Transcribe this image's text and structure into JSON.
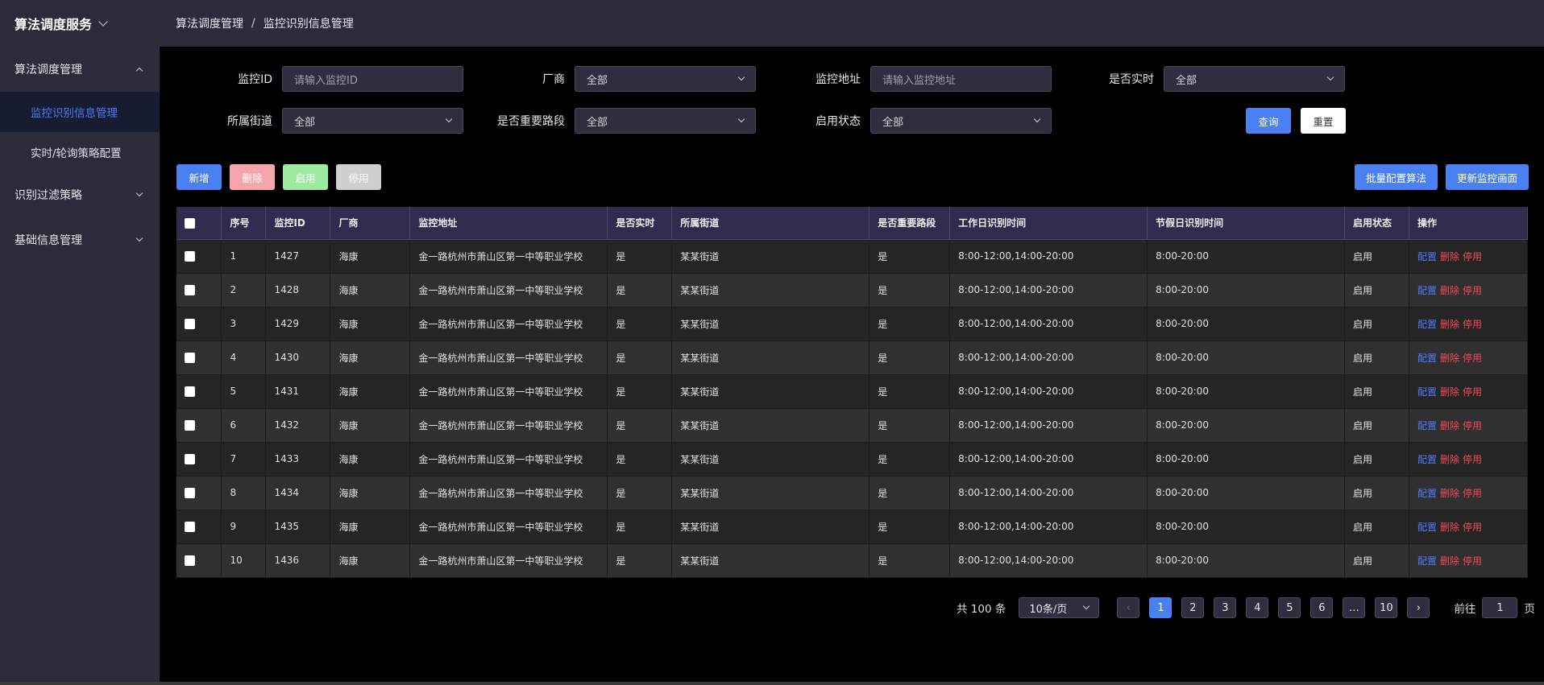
{
  "sidebar": {
    "app_title": "算法调度服务",
    "groups": [
      {
        "label": "算法调度管理",
        "children": [
          "监控识别信息管理",
          "实时/轮询策略配置"
        ]
      },
      {
        "label": "识别过滤策略"
      },
      {
        "label": "基础信息管理"
      }
    ]
  },
  "breadcrumb": {
    "root": "算法调度管理",
    "sep": "/",
    "current": "监控识别信息管理"
  },
  "filters": {
    "monitor_id": {
      "label": "监控ID",
      "placeholder": "请输入监控ID"
    },
    "vendor": {
      "label": "厂商",
      "value": "全部"
    },
    "address": {
      "label": "监控地址",
      "placeholder": "请输入监控地址"
    },
    "realtime": {
      "label": "是否实时",
      "value": "全部"
    },
    "street": {
      "label": "所属街道",
      "value": "全部"
    },
    "important_road": {
      "label": "是否重要路段",
      "value": "全部"
    },
    "enabled": {
      "label": "启用状态",
      "value": "全部"
    },
    "query_label": "查询",
    "reset_label": "重置"
  },
  "actions": {
    "add": "新增",
    "delete": "删除",
    "enable": "启用",
    "disable": "停用",
    "batch_config": "批量配置算法",
    "update_view": "更新监控画面",
    "colors": {
      "add": "#4a80f0",
      "delete": "#f7a5ad",
      "enable": "#9deba0",
      "disable": "#cfcfcf"
    }
  },
  "table": {
    "headers": [
      "序号",
      "监控ID",
      "厂商",
      "监控地址",
      "是否实时",
      "所属街道",
      "是否重要路段",
      "工作日识别时间",
      "节假日识别时间",
      "启用状态",
      "操作"
    ],
    "op_labels": {
      "config": "配置",
      "delete": "删除",
      "disable": "停用"
    },
    "rows": [
      [
        "1",
        "1427",
        "海康",
        "金一路杭州市萧山区第一中等职业学校",
        "是",
        "某某街道",
        "是",
        "8:00-12:00,14:00-20:00",
        "8:00-20:00",
        "启用"
      ],
      [
        "2",
        "1428",
        "海康",
        "金一路杭州市萧山区第一中等职业学校",
        "是",
        "某某街道",
        "是",
        "8:00-12:00,14:00-20:00",
        "8:00-20:00",
        "启用"
      ],
      [
        "3",
        "1429",
        "海康",
        "金一路杭州市萧山区第一中等职业学校",
        "是",
        "某某街道",
        "是",
        "8:00-12:00,14:00-20:00",
        "8:00-20:00",
        "启用"
      ],
      [
        "4",
        "1430",
        "海康",
        "金一路杭州市萧山区第一中等职业学校",
        "是",
        "某某街道",
        "是",
        "8:00-12:00,14:00-20:00",
        "8:00-20:00",
        "启用"
      ],
      [
        "5",
        "1431",
        "海康",
        "金一路杭州市萧山区第一中等职业学校",
        "是",
        "某某街道",
        "是",
        "8:00-12:00,14:00-20:00",
        "8:00-20:00",
        "启用"
      ],
      [
        "6",
        "1432",
        "海康",
        "金一路杭州市萧山区第一中等职业学校",
        "是",
        "某某街道",
        "是",
        "8:00-12:00,14:00-20:00",
        "8:00-20:00",
        "启用"
      ],
      [
        "7",
        "1433",
        "海康",
        "金一路杭州市萧山区第一中等职业学校",
        "是",
        "某某街道",
        "是",
        "8:00-12:00,14:00-20:00",
        "8:00-20:00",
        "启用"
      ],
      [
        "8",
        "1434",
        "海康",
        "金一路杭州市萧山区第一中等职业学校",
        "是",
        "某某街道",
        "是",
        "8:00-12:00,14:00-20:00",
        "8:00-20:00",
        "启用"
      ],
      [
        "9",
        "1435",
        "海康",
        "金一路杭州市萧山区第一中等职业学校",
        "是",
        "某某街道",
        "是",
        "8:00-12:00,14:00-20:00",
        "8:00-20:00",
        "启用"
      ],
      [
        "10",
        "1436",
        "海康",
        "金一路杭州市萧山区第一中等职业学校",
        "是",
        "某某街道",
        "是",
        "8:00-12:00,14:00-20:00",
        "8:00-20:00",
        "启用"
      ]
    ]
  },
  "pagination": {
    "total_text": "共 100 条",
    "page_size": "10条/页",
    "pages": [
      "1",
      "2",
      "3",
      "4",
      "5",
      "6",
      "…",
      "10"
    ],
    "current_page": "1",
    "goto_label": "前往",
    "goto_value": "1",
    "page_suffix": "页"
  }
}
